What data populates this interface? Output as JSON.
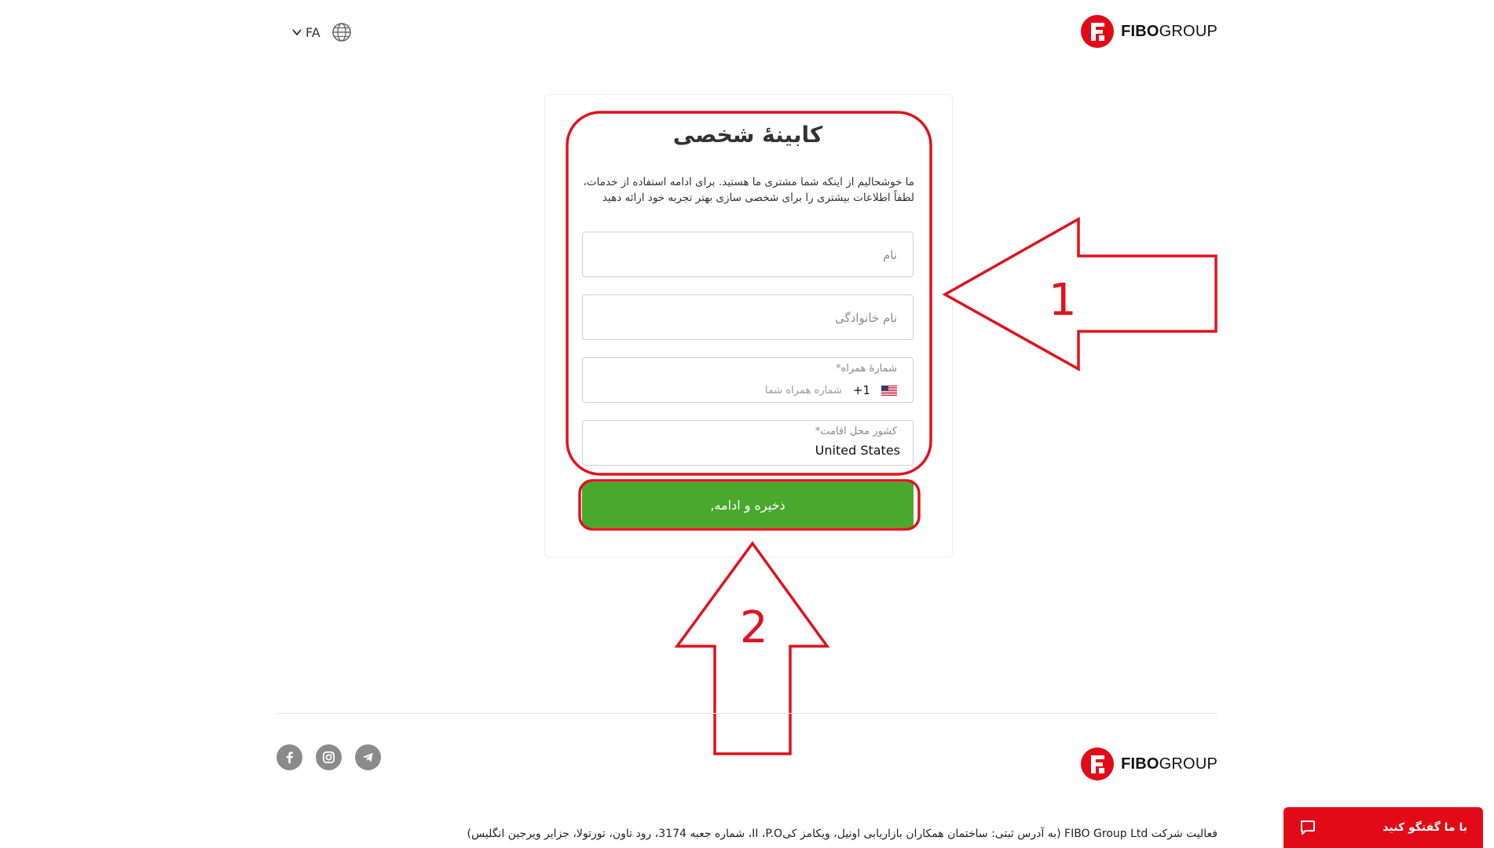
{
  "header": {
    "language_code": "FA",
    "logo": {
      "brand_strong": "FIBO",
      "brand_light": "GROUP"
    }
  },
  "card": {
    "title": "کابینهٔ شخصی",
    "intro": "ما خوشحالیم از اینکه شما مشتری ما هستید. برای ادامه استفاده از خدمات، لطفاً اطلاعات بیشتری را برای شخصی سازی بهتر تجربه خود ارائه دهید",
    "fields": {
      "first_name_placeholder": "نام",
      "last_name_placeholder": "نام خانوادگی",
      "phone_label": "شمارهٔ همراه*",
      "phone_country_code": "+1",
      "phone_placeholder": "شماره همراه شما",
      "country_label": "کشور محل اقامت*",
      "country_value": "United States"
    },
    "save_button": "ذخیره و ادامه,"
  },
  "annotations": {
    "arrow1_label": "1",
    "arrow2_label": "2",
    "color": "#e0121e"
  },
  "footer": {
    "logo": {
      "brand_strong": "FIBO",
      "brand_light": "GROUP"
    },
    "socials": [
      "facebook-icon",
      "instagram-icon",
      "telegram-icon"
    ],
    "legal": "فعالیت شرکت FIBO Group Ltd (به آدرس ثبتی: ساختمان همکاران بازاریابی اونیل، ویکامز کیII ،P.O، شماره جعبه 3174، رود تاون، تورتولا، جزایر ویرجین انگلیس)"
  },
  "chat": {
    "label": "با ما گفتگو کنید"
  },
  "colors": {
    "accent_green": "#4aa82d",
    "brand_red": "#e30a17"
  }
}
